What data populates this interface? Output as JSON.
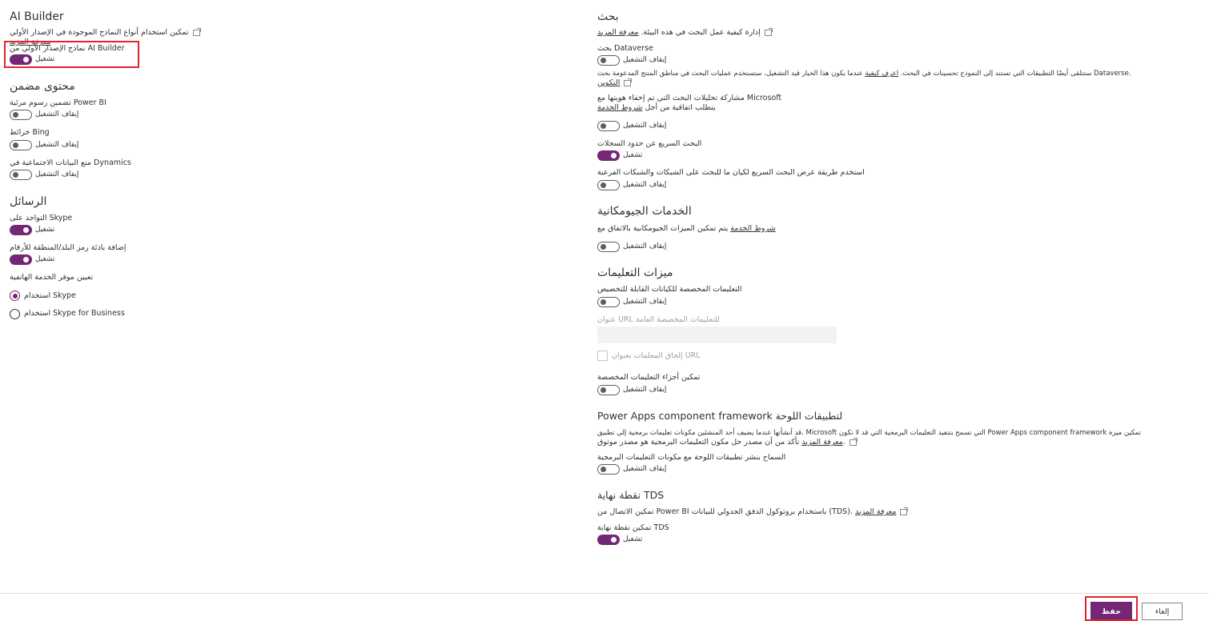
{
  "left": {
    "ai_builder": {
      "heading": "AI Builder",
      "desc": "تمكين استخدام أنواع النماذج الموجودة في الإصدار الأولي",
      "learn_more": "معرفة المزيد",
      "toggle_label": "نماذج الإصدار الأولي من AI Builder",
      "state": "تشغيل"
    },
    "embedded": {
      "heading": "محتوى مضمن",
      "items": [
        {
          "label": "تضمين رسوم مرئية Power BI",
          "state": "إيقاف التشغيل"
        },
        {
          "label": "خرائط Bing",
          "state": "إيقاف التشغيل"
        },
        {
          "label": "منع البيانات الاجتماعية في Dynamics",
          "state": "إيقاف التشغيل"
        }
      ]
    },
    "messages": {
      "heading": "الرسائل",
      "items": [
        {
          "label": "التواجد على Skype",
          "state": "تشغيل"
        },
        {
          "label": "إضافة بادئة رمز البلد/المنطقة للأرقام",
          "state": "تشغيل"
        }
      ],
      "provider_label": "تعيين موفر الخدمة الهاتفية",
      "radio_options": [
        "استخدام Skype",
        "استخدام Skype for Business"
      ]
    }
  },
  "right": {
    "search": {
      "heading": "بحث",
      "desc": "إدارة كيفية عمل البحث في هذه البيئة.",
      "learn_more": "معرفة المزيد",
      "dataverse_label": "بحث Dataverse",
      "dataverse_state": "إيقاف التشغيل",
      "dataverse_note": "ستتلقى أيضًا التطبيقات التي تستند إلى النموذج تحسينات في البحث.",
      "learn_how": "اعرف كيفية",
      "dataverse_note2": "عندما يكون هذا الخيار قيد التشغيل، ستستخدم عمليات البحث في مناطق المنتج المدعومة بحث Dataverse.",
      "config_link": "التكوين",
      "share_label": "مشاركة تحليلات البحث التي تم إخفاء هويتها مع Microsoft",
      "share_sub": "يتطلب اتفاقية من أجل",
      "terms_link": "شروط الخدمة",
      "share_state": "إيقاف التشغيل",
      "quick_label": "البحث السريع عن حدود السجلات",
      "quick_state": "تشغيل",
      "view_label": "استخدم طريقة عرض البحث السريع لكيان ما للبحث على الشبكات والشبكات الفرعية",
      "view_state": "إيقاف التشغيل"
    },
    "geo": {
      "heading": "الخدمات الجيومكانية",
      "desc": "يتم تمكين الميزات الجيومكانية بالاتفاق مع",
      "terms_link": "شروط الخدمة",
      "state": "إيقاف التشغيل"
    },
    "help": {
      "heading": "ميزات التعليمات",
      "custom_label": "التعليمات المخصصة للكيانات القابلة للتخصيص",
      "custom_state": "إيقاف التشغيل",
      "url_label": "عنوان URL للتعليمات المخصصة العامة",
      "append_label": "إلحاق المعلمات بعنوان URL",
      "parts_label": "تمكين أجزاء التعليمات المخصصة",
      "parts_state": "إيقاف التشغيل"
    },
    "pcf": {
      "heading": "Power Apps component framework لتطبيقات اللوحة",
      "desc": "قد أنشأتها عندما يضيف أحد المنشئين مكونات تعليمات برمجية إلى تطبيق. Microsoft التي تسمح بتنفيذ التعليمات البرمجية التي قد لا تكون Power Apps component framework تمكين ميزة",
      "desc2": "تأكد من أن مصدر حل مكون التعليمات البرمجية هو مصدر موثوق.",
      "learn_more": "معرفة المزيد",
      "toggle_label": "السماح بنشر تطبيقات اللوحة مع مكونات التعليمات البرمجية",
      "state": "إيقاف التشغيل"
    },
    "tds": {
      "heading": "نقطة نهاية TDS",
      "desc": "تمكين الاتصال من Power BI باستخدام بروتوكول الدفق الجدولي للبيانات (TDS).",
      "learn_more": "معرفة المزيد",
      "toggle_label": "تمكين نقطة نهاية TDS",
      "state": "تشغيل"
    }
  },
  "footer": {
    "save": "حفظ",
    "cancel": "إلغاء"
  },
  "colors": {
    "accent": "#742774",
    "highlight": "#e3242b"
  }
}
